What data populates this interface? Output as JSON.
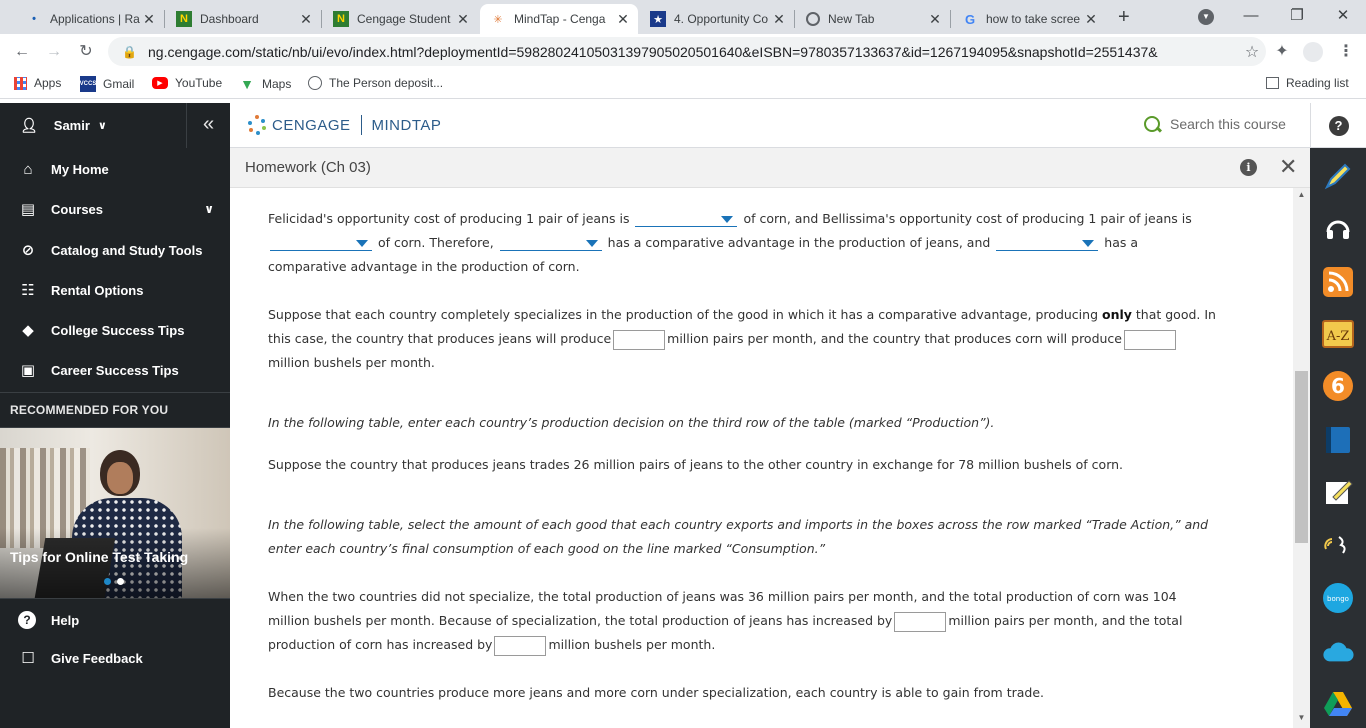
{
  "browser": {
    "tabs": [
      {
        "title": "Applications | Rap",
        "favicon": "rapid-icon"
      },
      {
        "title": "Dashboard",
        "favicon": "n-icon"
      },
      {
        "title": "Cengage Student",
        "favicon": "n-icon"
      },
      {
        "title": "MindTap - Cenga",
        "favicon": "cengage-icon"
      },
      {
        "title": "4. Opportunity Co",
        "favicon": "star-badge-icon"
      },
      {
        "title": "New Tab",
        "favicon": "chrome-icon"
      },
      {
        "title": "how to take scree",
        "favicon": "google-icon"
      }
    ],
    "url": "ng.cengage.com/static/nb/ui/evo/index.html?deploymentId=59828024105031397905020501640&eISBN=9780357133637&id=1267194095&snapshotId=2551437&",
    "bookmarks": [
      {
        "label": "Apps",
        "icon": "apps-grid-icon"
      },
      {
        "label": "Gmail",
        "icon": "vccs-icon"
      },
      {
        "label": "YouTube",
        "icon": "youtube-icon"
      },
      {
        "label": "Maps",
        "icon": "maps-icon"
      },
      {
        "label": "The Person deposit...",
        "icon": "globe-icon"
      }
    ],
    "reading_list": "Reading list",
    "vccs_badge": "VCCS"
  },
  "sidebar": {
    "user": "Samir",
    "items": [
      {
        "label": "My Home",
        "icon": "home-icon"
      },
      {
        "label": "Courses",
        "icon": "book-icon"
      },
      {
        "label": "Catalog and Study Tools",
        "icon": "compass-icon"
      },
      {
        "label": "Rental Options",
        "icon": "open-book-icon"
      },
      {
        "label": "College Success Tips",
        "icon": "grad-cap-icon"
      },
      {
        "label": "Career Success Tips",
        "icon": "briefcase-icon"
      }
    ],
    "recommended_heading": "RECOMMENDED FOR YOU",
    "promo_caption": "Tips for Online Test Taking",
    "bottom_items": [
      {
        "label": "Help",
        "icon": "question-icon"
      },
      {
        "label": "Give Feedback",
        "icon": "feedback-icon"
      }
    ]
  },
  "header": {
    "brand": "CENGAGE",
    "product": "MINDTAP",
    "search_placeholder": "Search this course",
    "help": "?"
  },
  "activity": {
    "title": "Homework (Ch 03)"
  },
  "content": {
    "p1": [
      "Felicidad's opportunity cost of producing 1 pair of jeans is",
      "of corn, and Bellissima's opportunity cost of producing 1 pair of jeans is",
      "of corn. Therefore,",
      "has a comparative advantage in the production of jeans, and",
      "has a",
      "comparative advantage in the production of corn."
    ],
    "p2": [
      "Suppose that each country completely specializes in the production of the good in which it has a comparative advantage, producing",
      "only",
      "that good. In",
      "this case, the country that produces jeans will produce",
      "million pairs per month, and the country that produces corn will produce",
      "million bushels per month."
    ],
    "p3": "In the following table, enter each country’s production decision on the third row of the table (marked “Production”).",
    "p4": "Suppose the country that produces jeans trades 26 million pairs of jeans to the other country in exchange for 78 million bushels of corn.",
    "p5": [
      "In the following table, select the amount of each good that each country exports and imports in the boxes across the row marked “Trade Action,” and",
      "enter each country’s final consumption of each good on the line marked “Consumption.”"
    ],
    "p6": [
      "When the two countries did not specialize, the total production of jeans was 36 million pairs per month, and the total production of corn was 104",
      "million bushels per month. Because of specialization, the total production of jeans has increased by",
      "million pairs per month, and the total",
      "production of corn has increased by",
      "million bushels per month."
    ],
    "p7": "Because the two countries produce more jeans and more corn under specialization, each country is able to gain from trade."
  },
  "dock": [
    "highlighter-icon",
    "headphones-icon",
    "rss-icon",
    "a-z-icon",
    "number-6-icon",
    "notebook-icon",
    "notes-icon",
    "read-speaker-icon",
    "bongo-icon",
    "cloud-icon",
    "drive-icon"
  ],
  "colors": {
    "sidebar_bg": "#1f2326",
    "accent_blue": "#1a73b8",
    "search_green": "#5a9a2a"
  }
}
